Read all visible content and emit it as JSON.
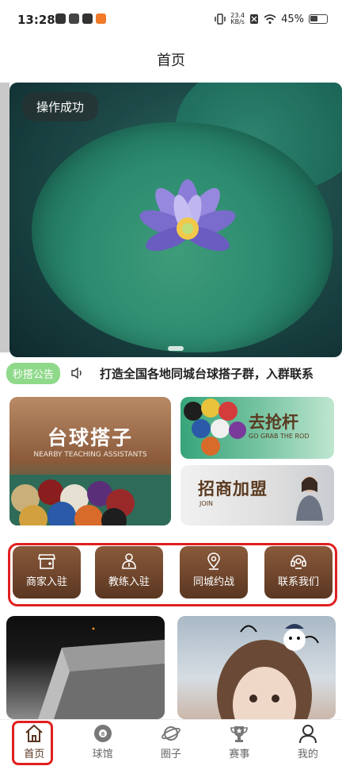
{
  "status_bar": {
    "time": "13:28",
    "net_speed_value": "23.4",
    "net_speed_unit": "KB/s",
    "battery": "45%"
  },
  "nav": {
    "title": "首页"
  },
  "banner": {
    "toast": "操作成功"
  },
  "notice": {
    "tag": "秒搭公告",
    "text": "打造全国各地同城台球搭子群，入群联系"
  },
  "cards": {
    "big": {
      "title": "台球搭子",
      "subtitle": "NEARBY TEACHING ASSISTANTS"
    },
    "grab": {
      "title": "去抢杆",
      "subtitle": "GO GRAB THE ROD"
    },
    "join": {
      "title": "招商加盟",
      "subtitle": "JOIN"
    }
  },
  "quick_actions": [
    {
      "label": "商家入驻",
      "icon": "shop-icon"
    },
    {
      "label": "教练入驻",
      "icon": "coach-icon"
    },
    {
      "label": "同城约战",
      "icon": "location-icon"
    },
    {
      "label": "联系我们",
      "icon": "support-icon"
    }
  ],
  "tabs": [
    {
      "label": "首页",
      "icon": "home-icon",
      "active": true
    },
    {
      "label": "球馆",
      "icon": "billiard-ball-icon",
      "active": false
    },
    {
      "label": "圈子",
      "icon": "planet-icon",
      "active": false
    },
    {
      "label": "赛事",
      "icon": "trophy-icon",
      "active": false
    },
    {
      "label": "我的",
      "icon": "profile-icon",
      "active": false
    }
  ],
  "colors": {
    "accent_brown": "#5a3621",
    "highlight_red": "#e02020",
    "notice_green": "#8fd98a"
  }
}
